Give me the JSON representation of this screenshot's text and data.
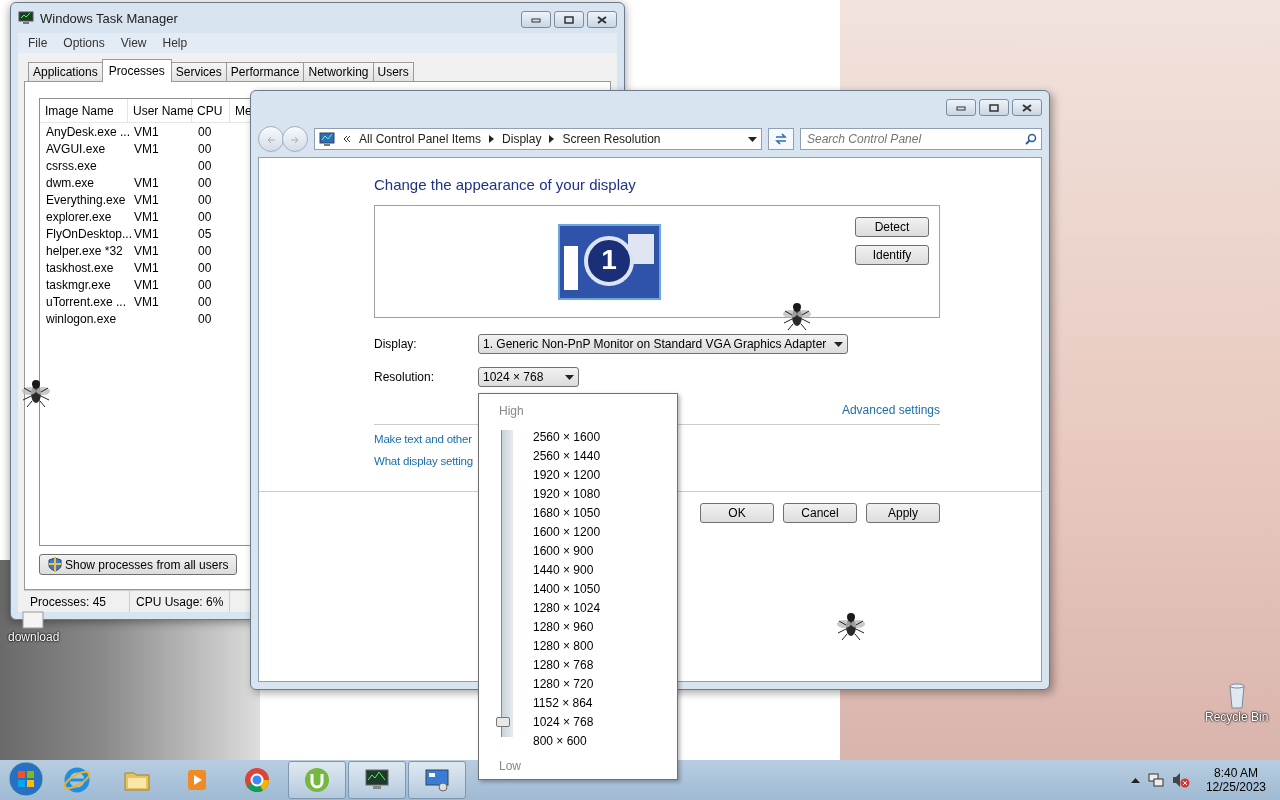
{
  "task_manager": {
    "title": "Windows Task Manager",
    "menu": [
      "File",
      "Options",
      "View",
      "Help"
    ],
    "tabs": [
      {
        "label": "Applications",
        "selected": false
      },
      {
        "label": "Processes",
        "selected": true
      },
      {
        "label": "Services",
        "selected": false
      },
      {
        "label": "Performance",
        "selected": false
      },
      {
        "label": "Networking",
        "selected": false
      },
      {
        "label": "Users",
        "selected": false
      }
    ],
    "columns": [
      "Image Name",
      "User Name",
      "CPU",
      "Me"
    ],
    "rows": [
      [
        "AnyDesk.exe ...",
        "VM1",
        "00"
      ],
      [
        "AVGUI.exe",
        "VM1",
        "00"
      ],
      [
        "csrss.exe",
        "",
        "00"
      ],
      [
        "dwm.exe",
        "VM1",
        "00"
      ],
      [
        "Everything.exe",
        "VM1",
        "00"
      ],
      [
        "explorer.exe",
        "VM1",
        "00"
      ],
      [
        "FlyOnDesktop...",
        "VM1",
        "05"
      ],
      [
        "helper.exe *32",
        "VM1",
        "00"
      ],
      [
        "taskhost.exe",
        "VM1",
        "00"
      ],
      [
        "taskmgr.exe",
        "VM1",
        "00"
      ],
      [
        "uTorrent.exe ...",
        "VM1",
        "00"
      ],
      [
        "winlogon.exe",
        "",
        "00"
      ]
    ],
    "button": "Show processes from all users",
    "status": [
      "Processes: 45",
      "CPU Usage: 6%"
    ]
  },
  "control_panel": {
    "breadcrumb": [
      "All Control Panel Items",
      "Display",
      "Screen Resolution"
    ],
    "search": {
      "placeholder": "Search Control Panel"
    },
    "heading": "Change the appearance of your display",
    "monitor_number": "1",
    "side_buttons": [
      "Detect",
      "Identify"
    ],
    "display_label": "Display:",
    "display_value": "1. Generic Non-PnP Monitor on Standard VGA Graphics Adapter",
    "resolution_label": "Resolution:",
    "resolution_value": "1024 × 768",
    "advanced_link": "Advanced settings",
    "links": [
      "Make text and other",
      "What display setting"
    ],
    "buttons": [
      "OK",
      "Cancel",
      "Apply"
    ]
  },
  "resolution_dropdown": {
    "high": "High",
    "low": "Low",
    "options": [
      {
        "label": "2560 × 1600",
        "selected": false
      },
      {
        "label": "2560 × 1440",
        "selected": false
      },
      {
        "label": "1920 × 1200",
        "selected": false
      },
      {
        "label": "1920 × 1080",
        "selected": false
      },
      {
        "label": "1680 × 1050",
        "selected": false
      },
      {
        "label": "1600 × 1200",
        "selected": false
      },
      {
        "label": "1600 × 900",
        "selected": false
      },
      {
        "label": "1440 × 900",
        "selected": false
      },
      {
        "label": "1400 × 1050",
        "selected": false
      },
      {
        "label": "1280 × 1024",
        "selected": false
      },
      {
        "label": "1280 × 960",
        "selected": false
      },
      {
        "label": "1280 × 800",
        "selected": false
      },
      {
        "label": "1280 × 768",
        "selected": false
      },
      {
        "label": "1280 × 720",
        "selected": false
      },
      {
        "label": "1152 × 864",
        "selected": false
      },
      {
        "label": "1024 × 768",
        "selected": true
      },
      {
        "label": "800 × 600",
        "selected": false
      }
    ]
  },
  "desktop_icons": [
    {
      "label": "download",
      "kind": "file"
    },
    {
      "label": "Recycle Bin",
      "kind": "bin"
    }
  ],
  "taskbar": {
    "apps": [
      {
        "kind": "ie",
        "running": false
      },
      {
        "kind": "folder",
        "running": false
      },
      {
        "kind": "media",
        "running": false
      },
      {
        "kind": "chrome",
        "running": false
      },
      {
        "kind": "torrent",
        "running": true
      },
      {
        "kind": "monitor",
        "running": true
      },
      {
        "kind": "control",
        "running": true
      }
    ],
    "time": "8:40 AM",
    "date": "12/25/2023"
  }
}
